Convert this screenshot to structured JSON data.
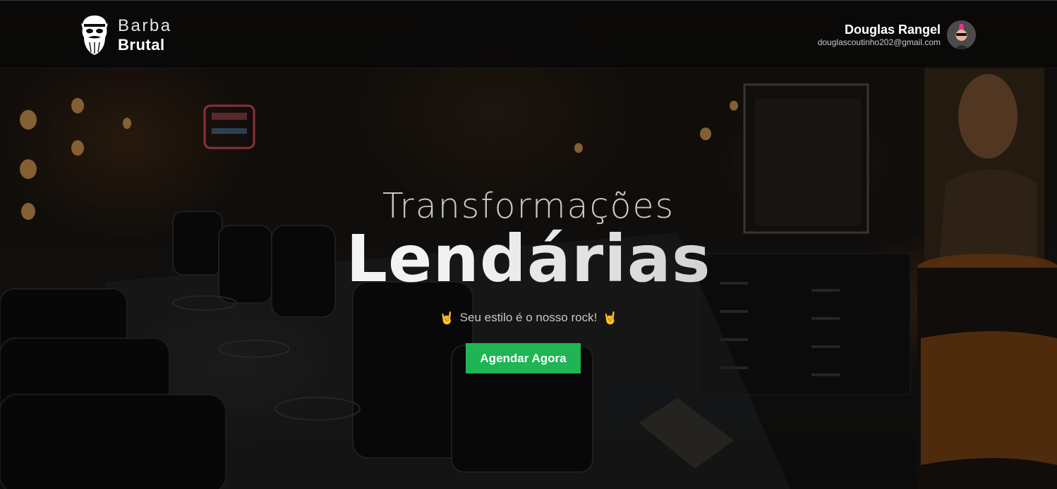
{
  "header": {
    "brand": {
      "line1": "Barba",
      "line2": "Brutal",
      "logo_icon": "bearded-skull-icon"
    },
    "user": {
      "name": "Douglas Rangel",
      "email": "douglascoutinho202@gmail.com",
      "avatar_icon": "punk-avatar-icon"
    }
  },
  "hero": {
    "headline_light": "Transformações",
    "headline_bold": "Lendárias",
    "tagline": "Seu estilo é o nosso rock!",
    "tagline_icon": "rock-hand-icon",
    "cta_label": "Agendar Agora"
  },
  "colors": {
    "cta_background": "#1fb554",
    "header_background": "#080808",
    "text_primary": "#ffffff"
  }
}
